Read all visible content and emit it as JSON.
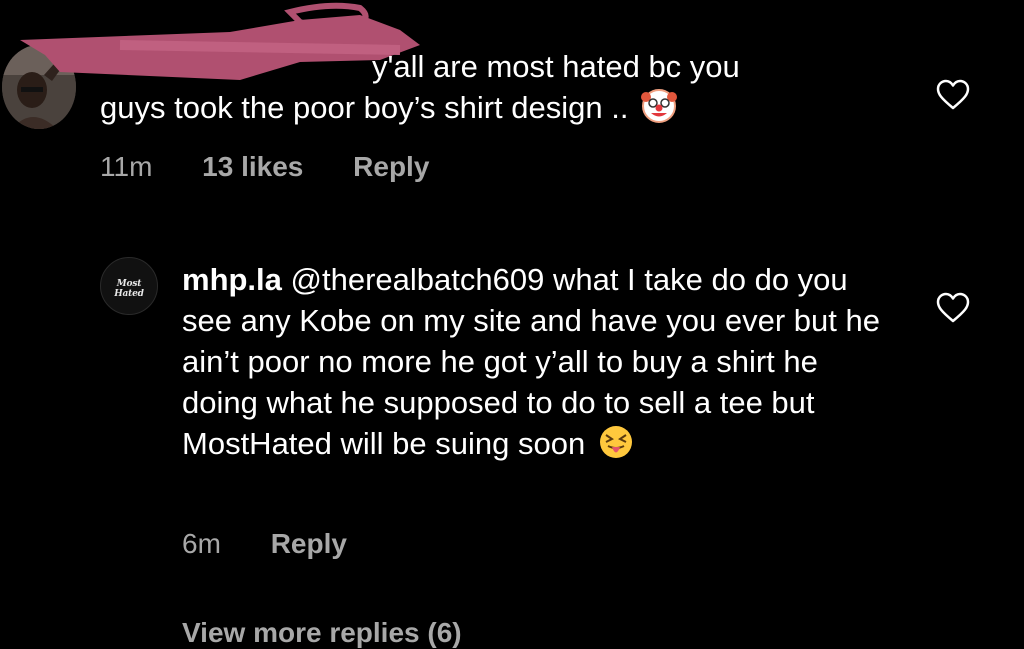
{
  "comments": [
    {
      "text_line1": "y'all are most hated bc you",
      "text_line2": "guys took the poor boy’s shirt design ..",
      "emoji": "clown-face-emoji",
      "time": "11m",
      "likes": "13 likes",
      "reply_label": "Reply"
    },
    {
      "username": "mhp.la",
      "mention": "@therealbatch609",
      "text": " what I take do do you see any Kobe on my site and have you ever but he ain’t poor no more he got y’all to buy a shirt he doing what he supposed to do to sell a tee but MostHated will be suing soon",
      "avatar_logo": "Most Hated",
      "emoji": "squinting-face-with-tongue-emoji",
      "time": "6m",
      "reply_label": "Reply"
    }
  ],
  "view_more_label": "View more replies (6)",
  "colors": {
    "background": "#000000",
    "text": "#ffffff",
    "meta": "#a8a8a8",
    "redaction": "#b05070"
  }
}
